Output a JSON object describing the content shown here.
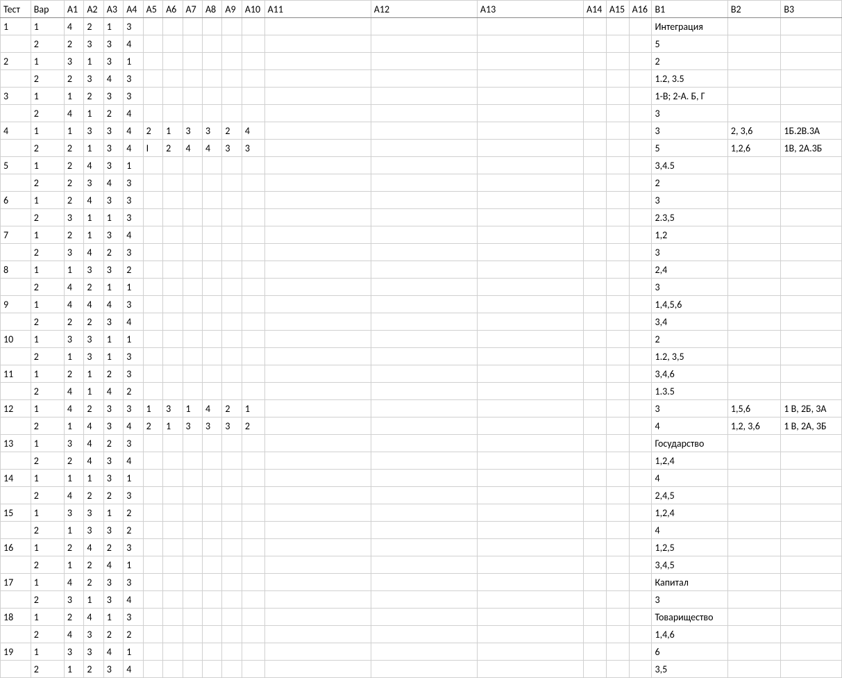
{
  "headers": [
    "Тест",
    "Вар",
    "А1",
    "А2",
    "А3",
    "А4",
    "А5",
    "А6",
    "А7",
    "А8",
    "А9",
    "А10",
    "А11",
    "А12",
    "А13",
    "А14",
    "А15",
    "А16",
    "В1",
    "В2",
    "В3"
  ],
  "rows": [
    [
      "1",
      "1",
      "4",
      "2",
      "1",
      "3",
      "",
      "",
      "",
      "",
      "",
      "",
      "",
      "",
      "",
      "",
      "",
      "",
      "Интеграция",
      "",
      ""
    ],
    [
      "",
      "2",
      "2",
      "3",
      "3",
      "4",
      "",
      "",
      "",
      "",
      "",
      "",
      "",
      "",
      "",
      "",
      "",
      "",
      "5",
      "",
      ""
    ],
    [
      "2",
      "1",
      "3",
      "1",
      "3",
      "1",
      "",
      "",
      "",
      "",
      "",
      "",
      "",
      "",
      "",
      "",
      "",
      "",
      "2",
      "",
      ""
    ],
    [
      "",
      "2",
      "2",
      "3",
      "4",
      "3",
      "",
      "",
      "",
      "",
      "",
      "",
      "",
      "",
      "",
      "",
      "",
      "",
      "1.2, 3.5",
      "",
      ""
    ],
    [
      "3",
      "1",
      "1",
      "2",
      "3",
      "3",
      "",
      "",
      "",
      "",
      "",
      "",
      "",
      "",
      "",
      "",
      "",
      "",
      "1-В; 2-А. Б, Г",
      "",
      ""
    ],
    [
      "",
      "2",
      "4",
      "1",
      "2",
      "4",
      "",
      "",
      "",
      "",
      "",
      "",
      "",
      "",
      "",
      "",
      "",
      "",
      "3",
      "",
      ""
    ],
    [
      "4",
      "1",
      "1",
      "3",
      "3",
      "4",
      "2",
      "1",
      "3",
      "3",
      "2",
      "4",
      "",
      "",
      "",
      "",
      "",
      "",
      "3",
      "2, 3,6",
      "1Б.2В.3А"
    ],
    [
      "",
      "2",
      "2",
      "1",
      "3",
      "4",
      "I",
      "2",
      "4",
      "4",
      "3",
      "3",
      "",
      "",
      "",
      "",
      "",
      "",
      "5",
      "1,2,6",
      "1В, 2А.3Б"
    ],
    [
      "5",
      "1",
      "2",
      "4",
      "3",
      "1",
      "",
      "",
      "",
      "",
      "",
      "",
      "",
      "",
      "",
      "",
      "",
      "",
      "3,4.5",
      "",
      ""
    ],
    [
      "",
      "2",
      "2",
      "3",
      "4",
      "3",
      "",
      "",
      "",
      "",
      "",
      "",
      "",
      "",
      "",
      "",
      "",
      "",
      "2",
      "",
      ""
    ],
    [
      "6",
      "1",
      "2",
      "4",
      "3",
      "3",
      "",
      "",
      "",
      "",
      "",
      "",
      "",
      "",
      "",
      "",
      "",
      "",
      "3",
      "",
      ""
    ],
    [
      "",
      "2",
      "3",
      "1",
      "1",
      "3",
      "",
      "",
      "",
      "",
      "",
      "",
      "",
      "",
      "",
      "",
      "",
      "",
      "2.3,5",
      "",
      ""
    ],
    [
      "7",
      "1",
      "2",
      "1",
      "3",
      "4",
      "",
      "",
      "",
      "",
      "",
      "",
      "",
      "",
      "",
      "",
      "",
      "",
      "1,2",
      "",
      ""
    ],
    [
      "",
      "2",
      "3",
      "4",
      "2",
      "3",
      "",
      "",
      "",
      "",
      "",
      "",
      "",
      "",
      "",
      "",
      "",
      "",
      "3",
      "",
      ""
    ],
    [
      "8",
      "1",
      "1",
      "3",
      "3",
      "2",
      "",
      "",
      "",
      "",
      "",
      "",
      "",
      "",
      "",
      "",
      "",
      "",
      "2,4",
      "",
      ""
    ],
    [
      "",
      "2",
      "4",
      "2",
      "1",
      "1",
      "",
      "",
      "",
      "",
      "",
      "",
      "",
      "",
      "",
      "",
      "",
      "",
      "3",
      "",
      ""
    ],
    [
      "9",
      "1",
      "4",
      "4",
      "4",
      "3",
      "",
      "",
      "",
      "",
      "",
      "",
      "",
      "",
      "",
      "",
      "",
      "",
      "1,4,5,6",
      "",
      ""
    ],
    [
      "",
      "2",
      "2",
      "2",
      "3",
      "4",
      "",
      "",
      "",
      "",
      "",
      "",
      "",
      "",
      "",
      "",
      "",
      "",
      "3,4",
      "",
      ""
    ],
    [
      "10",
      "1",
      "3",
      "3",
      "1",
      "1",
      "",
      "",
      "",
      "",
      "",
      "",
      "",
      "",
      "",
      "",
      "",
      "",
      "2",
      "",
      ""
    ],
    [
      "",
      "2",
      "1",
      "3",
      "1",
      "3",
      "",
      "",
      "",
      "",
      "",
      "",
      "",
      "",
      "",
      "",
      "",
      "",
      "1.2, 3,5",
      "",
      ""
    ],
    [
      "11",
      "1",
      "2",
      "1",
      "2",
      "3",
      "",
      "",
      "",
      "",
      "",
      "",
      "",
      "",
      "",
      "",
      "",
      "",
      "3,4,6",
      "",
      ""
    ],
    [
      "",
      "2",
      "4",
      "1",
      "4",
      "2",
      "",
      "",
      "",
      "",
      "",
      "",
      "",
      "",
      "",
      "",
      "",
      "",
      "1.3.5",
      "",
      ""
    ],
    [
      "12",
      "1",
      "4",
      "2",
      "3",
      "3",
      "1",
      "3",
      "1",
      "4",
      "2",
      "1",
      "",
      "",
      "",
      "",
      "",
      "",
      "3",
      "1,5,6",
      "1 В, 2Б, 3А"
    ],
    [
      "",
      "2",
      "1",
      "4",
      "3",
      "4",
      "2",
      "1",
      "3",
      "3",
      "3",
      "2",
      "",
      "",
      "",
      "",
      "",
      "",
      "4",
      "1,2, 3,6",
      "1 В, 2А, 3Б"
    ],
    [
      "13",
      "1",
      "3",
      "4",
      "2",
      "3",
      "",
      "",
      "",
      "",
      "",
      "",
      "",
      "",
      "",
      "",
      "",
      "",
      "Государство",
      "",
      ""
    ],
    [
      "",
      "2",
      "2",
      "4",
      "3",
      "4",
      "",
      "",
      "",
      "",
      "",
      "",
      "",
      "",
      "",
      "",
      "",
      "",
      "1,2,4",
      "",
      ""
    ],
    [
      "14",
      "1",
      "1",
      "1",
      "3",
      "1",
      "",
      "",
      "",
      "",
      "",
      "",
      "",
      "",
      "",
      "",
      "",
      "",
      "4",
      "",
      ""
    ],
    [
      "",
      "2",
      "4",
      "2",
      "2",
      "3",
      "",
      "",
      "",
      "",
      "",
      "",
      "",
      "",
      "",
      "",
      "",
      "",
      "2,4,5",
      "",
      ""
    ],
    [
      "15",
      "1",
      "3",
      "3",
      "1",
      "2",
      "",
      "",
      "",
      "",
      "",
      "",
      "",
      "",
      "",
      "",
      "",
      "",
      "1,2,4",
      "",
      ""
    ],
    [
      "",
      "2",
      "1",
      "3",
      "3",
      "2",
      "",
      "",
      "",
      "",
      "",
      "",
      "",
      "",
      "",
      "",
      "",
      "",
      "4",
      "",
      ""
    ],
    [
      "16",
      "1",
      "2",
      "4",
      "2",
      "3",
      "",
      "",
      "",
      "",
      "",
      "",
      "",
      "",
      "",
      "",
      "",
      "",
      "1,2,5",
      "",
      ""
    ],
    [
      "",
      "2",
      "1",
      "2",
      "4",
      "1",
      "",
      "",
      "",
      "",
      "",
      "",
      "",
      "",
      "",
      "",
      "",
      "",
      "3,4,5",
      "",
      ""
    ],
    [
      "17",
      "1",
      "4",
      "2",
      "3",
      "3",
      "",
      "",
      "",
      "",
      "",
      "",
      "",
      "",
      "",
      "",
      "",
      "",
      "Капитал",
      "",
      ""
    ],
    [
      "",
      "2",
      "3",
      "1",
      "3",
      "4",
      "",
      "",
      "",
      "",
      "",
      "",
      "",
      "",
      "",
      "",
      "",
      "",
      "3",
      "",
      ""
    ],
    [
      "18",
      "1",
      "2",
      "4",
      "1",
      "3",
      "",
      "",
      "",
      "",
      "",
      "",
      "",
      "",
      "",
      "",
      "",
      "",
      "Товарищество",
      "",
      ""
    ],
    [
      "",
      "2",
      "4",
      "3",
      "2",
      "2",
      "",
      "",
      "",
      "",
      "",
      "",
      "",
      "",
      "",
      "",
      "",
      "",
      "1,4,6",
      "",
      ""
    ],
    [
      "19",
      "1",
      "3",
      "3",
      "4",
      "1",
      "",
      "",
      "",
      "",
      "",
      "",
      "",
      "",
      "",
      "",
      "",
      "",
      "6",
      "",
      ""
    ],
    [
      "",
      "2",
      "1",
      "2",
      "3",
      "4",
      "",
      "",
      "",
      "",
      "",
      "",
      "",
      "",
      "",
      "",
      "",
      "",
      "3,5",
      "",
      ""
    ]
  ]
}
